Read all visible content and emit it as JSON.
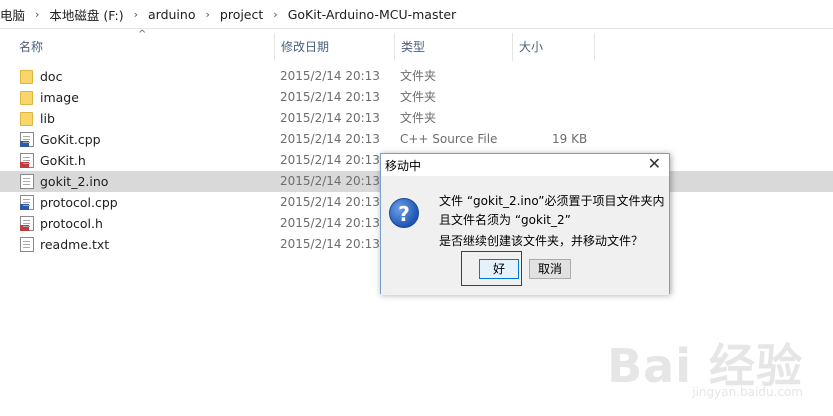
{
  "breadcrumb": [
    "电脑",
    "本地磁盘 (F:)",
    "arduino",
    "project",
    "GoKit-Arduino-MCU-master"
  ],
  "columns": {
    "name": "名称",
    "date": "修改日期",
    "type": "类型",
    "size": "大小"
  },
  "files": [
    {
      "name": "doc",
      "date": "2015/2/14 20:13",
      "type": "文件夹",
      "size": "",
      "icon": "folder-icon"
    },
    {
      "name": "image",
      "date": "2015/2/14 20:13",
      "type": "文件夹",
      "size": "",
      "icon": "folder-icon"
    },
    {
      "name": "lib",
      "date": "2015/2/14 20:13",
      "type": "文件夹",
      "size": "",
      "icon": "folder-icon"
    },
    {
      "name": "GoKit.cpp",
      "date": "2015/2/14 20:13",
      "type": "C++ Source File",
      "size": "19 KB",
      "icon": "cpp-file-icon"
    },
    {
      "name": "GoKit.h",
      "date": "2015/2/14 20:13",
      "type": "",
      "size": "",
      "icon": "header-file-icon"
    },
    {
      "name": "gokit_2.ino",
      "date": "2015/2/14 20:13",
      "type": "",
      "size": "",
      "icon": "text-file-icon",
      "selected": true
    },
    {
      "name": "protocol.cpp",
      "date": "2015/2/14 20:13",
      "type": "",
      "size": "",
      "icon": "cpp-file-icon"
    },
    {
      "name": "protocol.h",
      "date": "2015/2/14 20:13",
      "type": "",
      "size": "",
      "icon": "header-file-icon"
    },
    {
      "name": "readme.txt",
      "date": "2015/2/14 20:13",
      "type": "",
      "size": "",
      "icon": "text-file-icon"
    }
  ],
  "dialog": {
    "title": "移动中",
    "close": "✕",
    "icon": "question-icon",
    "icon_glyph": "?",
    "line1": "文件 “gokit_2.ino”必须置于项目文件夹内",
    "line2": "且文件名须为 “gokit_2”",
    "line3": "是否继续创建该文件夹，并移动文件？",
    "ok": "好",
    "cancel": "取消"
  },
  "watermark": {
    "main": "Bai 经验",
    "sub": "jingyan.baidu.com"
  }
}
